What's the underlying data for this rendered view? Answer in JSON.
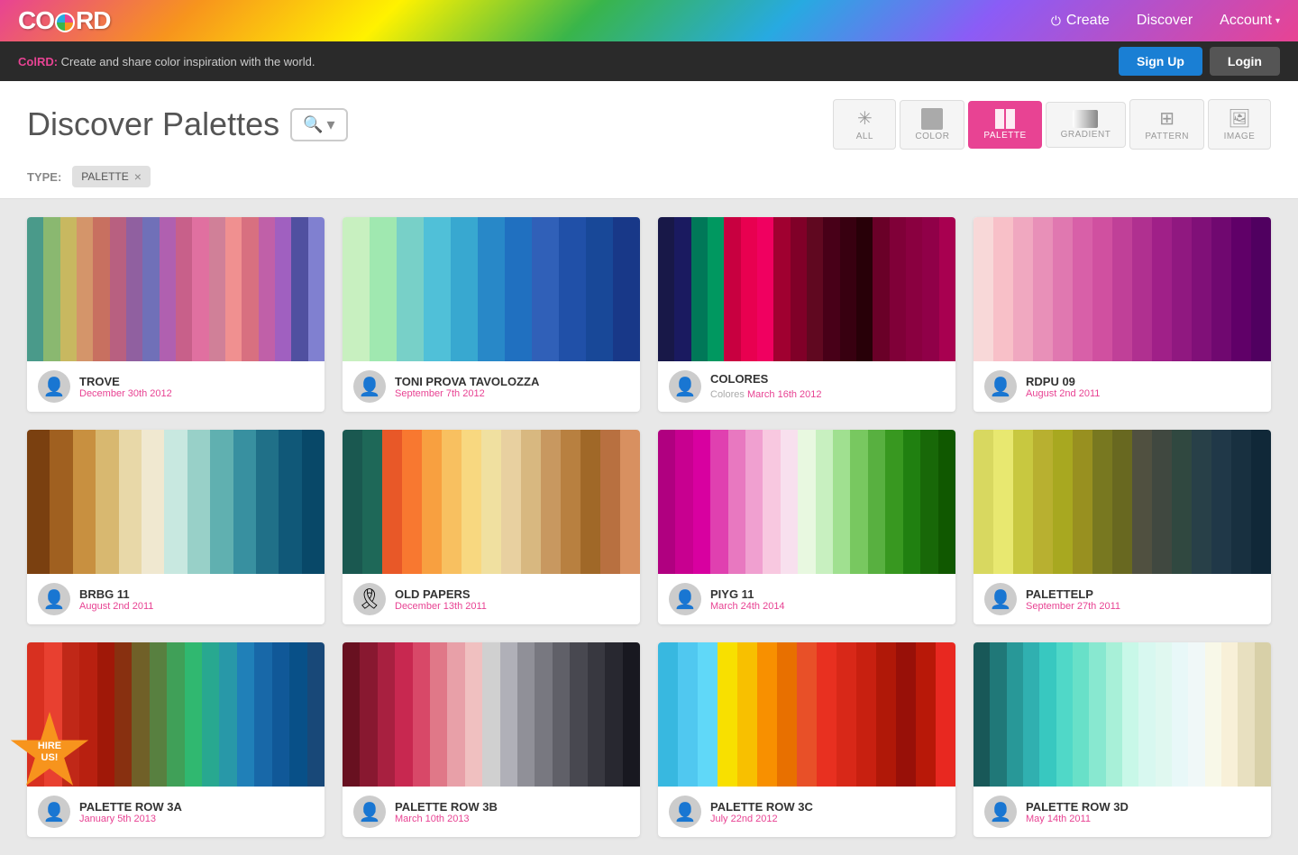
{
  "header": {
    "logo": "COLRD",
    "nav": {
      "create": "Create",
      "discover": "Discover",
      "account": "Account"
    }
  },
  "announcement": {
    "brand": "ColRD:",
    "text": " Create and share color inspiration with the world.",
    "signup": "Sign Up",
    "login": "Login"
  },
  "discover": {
    "title": "Discover Palettes",
    "search_icon": "🔍",
    "filters": [
      {
        "id": "all",
        "icon": "✳",
        "label": "ALL"
      },
      {
        "id": "color",
        "icon": "▣",
        "label": "COLOR"
      },
      {
        "id": "palette",
        "icon": "▌▐",
        "label": "PALETTE",
        "active": true
      },
      {
        "id": "gradient",
        "icon": "▬",
        "label": "GRADIENT"
      },
      {
        "id": "pattern",
        "icon": "⊞",
        "label": "PATTERN"
      },
      {
        "id": "image",
        "icon": "🖼",
        "label": "IMAGE"
      }
    ]
  },
  "type_filter": {
    "label": "TYPE:",
    "tag": "PALETTE",
    "close": "×"
  },
  "palettes": [
    {
      "name": "TROVE",
      "date": "December 30th 2012",
      "sub": "",
      "avatar": "person",
      "swatches": [
        "#4a9a8a",
        "#8ab870",
        "#c8b860",
        "#d4956a",
        "#c87060",
        "#b86080",
        "#9060a0",
        "#7070b8",
        "#b060b0",
        "#c8608a",
        "#e070a0",
        "#d08098",
        "#f09090",
        "#d87080",
        "#c060a8",
        "#a060c0",
        "#5050a0",
        "#8080d0"
      ]
    },
    {
      "name": "TONI PROVA TAVOLOZZA",
      "date": "September 7th 2012",
      "sub": "",
      "avatar": "person",
      "swatches": [
        "#c8f0c0",
        "#a0e8b0",
        "#78d0c8",
        "#50c0d8",
        "#38a8d0",
        "#2888c8",
        "#2070c0",
        "#3060b8",
        "#2050a8",
        "#184898",
        "#183888"
      ]
    },
    {
      "name": "COLORES",
      "date": "March 16th 2012",
      "sub": "Colores ",
      "avatar": "person",
      "swatches": [
        "#181848",
        "#1a1a60",
        "#007858",
        "#009860",
        "#c80040",
        "#e80050",
        "#f00060",
        "#a00030",
        "#800028",
        "#600820",
        "#480018",
        "#380010",
        "#280008",
        "#6a0028",
        "#800038",
        "#8a0040",
        "#900048",
        "#a80050"
      ]
    },
    {
      "name": "RDPU 09",
      "date": "August 2nd 2011",
      "sub": "",
      "avatar": "person",
      "swatches": [
        "#f8d8d8",
        "#f8c0c8",
        "#f0a8c0",
        "#e890b8",
        "#e078b0",
        "#d860a8",
        "#d050a0",
        "#c04098",
        "#b03090",
        "#a02088",
        "#901880",
        "#801078",
        "#700870",
        "#600068",
        "#500060"
      ]
    },
    {
      "name": "BRBG 11",
      "date": "August 2nd 2011",
      "sub": "",
      "avatar": "person",
      "swatches": [
        "#7a4010",
        "#a06020",
        "#c89040",
        "#d8b870",
        "#e8d8a8",
        "#f0e8d0",
        "#c8e8e0",
        "#98d0c8",
        "#60b0b0",
        "#3890a0",
        "#207088",
        "#105878",
        "#084868"
      ]
    },
    {
      "name": "OLD PAPERS",
      "date": "December 13th 2011",
      "sub": "",
      "avatar": "ribbon",
      "swatches": [
        "#1a5850",
        "#1e6858",
        "#e85828",
        "#f87830",
        "#f8a040",
        "#f8c060",
        "#f8d880",
        "#f0e0a0",
        "#e8d0a0",
        "#d8b880",
        "#c89860",
        "#b88040",
        "#a06828",
        "#b87040",
        "#d89060"
      ]
    },
    {
      "name": "PIYG 11",
      "date": "March 24th 2014",
      "sub": "",
      "avatar": "person",
      "swatches": [
        "#b00080",
        "#c80090",
        "#d800a0",
        "#e040b0",
        "#e878c0",
        "#f0a0d0",
        "#f8c8e0",
        "#f8e0ee",
        "#e8f8e0",
        "#c8f0c0",
        "#a0e090",
        "#78c860",
        "#58b040",
        "#389820",
        "#208010",
        "#186808",
        "#105800"
      ]
    },
    {
      "name": "PALETTELP",
      "date": "September 27th 2011",
      "sub": "",
      "avatar": "person",
      "swatches": [
        "#d8d860",
        "#e8e870",
        "#c8c840",
        "#b8b030",
        "#a8a820",
        "#989020",
        "#787820",
        "#686820",
        "#505040",
        "#404840",
        "#304840",
        "#284048",
        "#203848",
        "#183040",
        "#102838"
      ]
    },
    {
      "name": "PALETTE ROW 3A",
      "date": "January 5th 2013",
      "sub": "",
      "avatar": "person",
      "swatches": [
        "#d83020",
        "#e84030",
        "#c02818",
        "#b82010",
        "#a01808",
        "#883010",
        "#706028",
        "#588040",
        "#40a058",
        "#30b870",
        "#28a890",
        "#2898a8",
        "#2080b8",
        "#1868a8",
        "#105898",
        "#085088",
        "#184878"
      ]
    },
    {
      "name": "PALETTE ROW 3B",
      "date": "March 10th 2013",
      "sub": "",
      "avatar": "person",
      "swatches": [
        "#681020",
        "#881830",
        "#a82040",
        "#c82850",
        "#d84868",
        "#e07888",
        "#e8a0a8",
        "#f0c0c0",
        "#d0d0d0",
        "#b0b0b8",
        "#909098",
        "#787880",
        "#606068",
        "#484850",
        "#383840",
        "#282830",
        "#181820"
      ]
    },
    {
      "name": "PALETTE ROW 3C",
      "date": "July 22nd 2012",
      "sub": "",
      "avatar": "person",
      "swatches": [
        "#38b8e0",
        "#50c8f0",
        "#60d8f8",
        "#f8e000",
        "#f8c000",
        "#f89000",
        "#e87000",
        "#e85028",
        "#e83020",
        "#d82818",
        "#c82010",
        "#b01808",
        "#981008",
        "#b81808",
        "#e82820"
      ]
    },
    {
      "name": "PALETTE ROW 3D",
      "date": "May 14th 2011",
      "sub": "",
      "avatar": "person",
      "swatches": [
        "#185858",
        "#207878",
        "#289898",
        "#30b0b0",
        "#38c8c0",
        "#50d8c8",
        "#68e0c8",
        "#88e8d0",
        "#a8f0d8",
        "#c8f8e8",
        "#d8f8f0",
        "#e0f8f0",
        "#e8f8f8",
        "#f0f8f8",
        "#f8f8e8",
        "#f8f0d8",
        "#e8e0c0",
        "#d8d0a8"
      ]
    }
  ],
  "hire": {
    "line1": "HIRE",
    "line2": "US!"
  }
}
